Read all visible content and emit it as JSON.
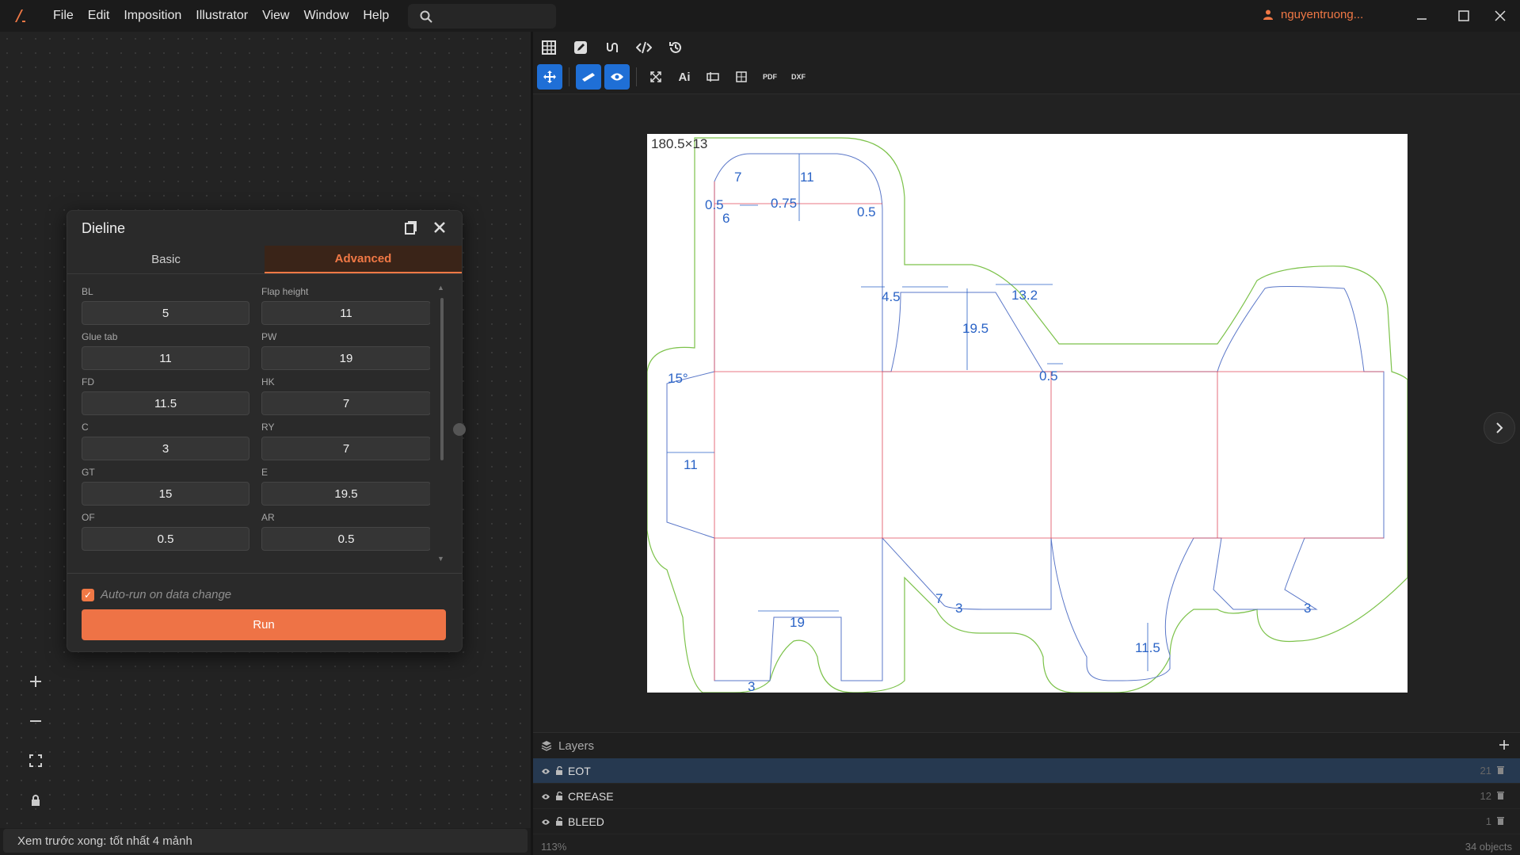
{
  "menu": [
    "File",
    "Edit",
    "Imposition",
    "Illustrator",
    "View",
    "Window",
    "Help"
  ],
  "user": {
    "name": "nguyentruong..."
  },
  "dieline": {
    "title": "Dieline",
    "tabs": [
      "Basic",
      "Advanced"
    ],
    "fields": [
      {
        "label": "BL",
        "value": "5"
      },
      {
        "label": "Flap height",
        "value": "11"
      },
      {
        "label": "Glue tab",
        "value": "11"
      },
      {
        "label": "PW",
        "value": "19"
      },
      {
        "label": "FD",
        "value": "11.5"
      },
      {
        "label": "HK",
        "value": "7"
      },
      {
        "label": "C",
        "value": "3"
      },
      {
        "label": "RY",
        "value": "7"
      },
      {
        "label": "GT",
        "value": "15"
      },
      {
        "label": "E",
        "value": "19.5"
      },
      {
        "label": "OF",
        "value": "0.5"
      },
      {
        "label": "AR",
        "value": "0.5"
      }
    ],
    "auto_run_label": "Auto-run on data change",
    "run_label": "Run"
  },
  "status_left": "Xem trước xong: tốt nhất 4 mảnh",
  "toolbar2": {
    "ai": "Ai",
    "pdf": "PDF",
    "dxf": "DXF"
  },
  "artboard_label": "180.5×13",
  "dimensions": [
    "7",
    "11",
    "0.5",
    "0.75",
    "0.5",
    "6",
    "4.5",
    "13.2",
    "19.5",
    "0.5",
    "15°",
    "11",
    "7",
    "3",
    "19",
    "3",
    "11.5",
    "3"
  ],
  "layers": {
    "title": "Layers",
    "items": [
      {
        "name": "EOT",
        "count": "21"
      },
      {
        "name": "CREASE",
        "count": "12"
      },
      {
        "name": "BLEED",
        "count": "1"
      }
    ]
  },
  "status_right": {
    "zoom": "113%",
    "objects": "34 objects"
  },
  "colors": {
    "accent": "#ee7346",
    "cut": "#5a77c8",
    "crease": "#e04a5a",
    "bleed": "#7cc24a",
    "dimension": "#2a63c6"
  }
}
